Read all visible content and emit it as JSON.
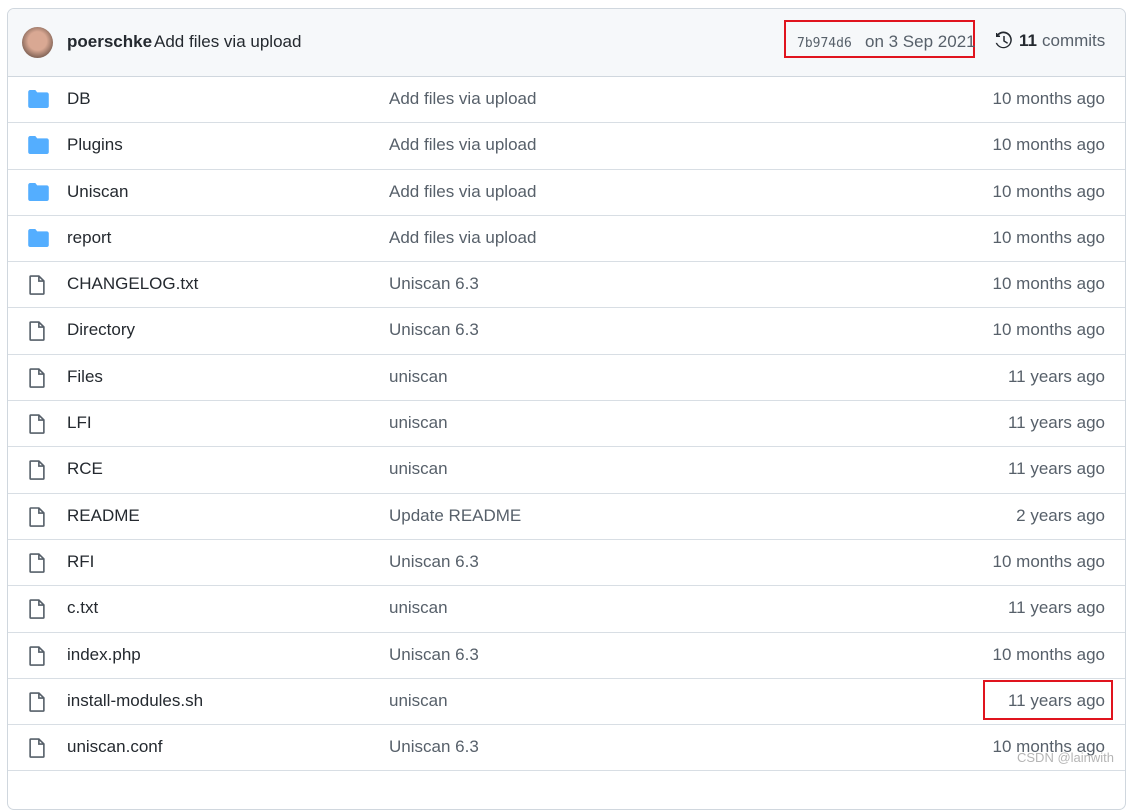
{
  "header": {
    "author": "poerschke",
    "message": "Add files via upload",
    "sha": "7b974d6",
    "date": "on 3 Sep 2021",
    "commit_count": "11",
    "commit_label": "commits"
  },
  "colors": {
    "folder": "#54aeff",
    "highlight": "#e0141e"
  },
  "files": [
    {
      "type": "folder",
      "name": "DB",
      "message": "Add files via upload",
      "age": "10 months ago"
    },
    {
      "type": "folder",
      "name": "Plugins",
      "message": "Add files via upload",
      "age": "10 months ago"
    },
    {
      "type": "folder",
      "name": "Uniscan",
      "message": "Add files via upload",
      "age": "10 months ago"
    },
    {
      "type": "folder",
      "name": "report",
      "message": "Add files via upload",
      "age": "10 months ago"
    },
    {
      "type": "file",
      "name": "CHANGELOG.txt",
      "message": "Uniscan 6.3",
      "age": "10 months ago"
    },
    {
      "type": "file",
      "name": "Directory",
      "message": "Uniscan 6.3",
      "age": "10 months ago"
    },
    {
      "type": "file",
      "name": "Files",
      "message": "uniscan",
      "age": "11 years ago"
    },
    {
      "type": "file",
      "name": "LFI",
      "message": "uniscan",
      "age": "11 years ago"
    },
    {
      "type": "file",
      "name": "RCE",
      "message": "uniscan",
      "age": "11 years ago"
    },
    {
      "type": "file",
      "name": "README",
      "message": "Update README",
      "age": "2 years ago"
    },
    {
      "type": "file",
      "name": "RFI",
      "message": "Uniscan 6.3",
      "age": "10 months ago"
    },
    {
      "type": "file",
      "name": "c.txt",
      "message": "uniscan",
      "age": "11 years ago"
    },
    {
      "type": "file",
      "name": "index.php",
      "message": "Uniscan 6.3",
      "age": "10 months ago"
    },
    {
      "type": "file",
      "name": "install-modules.sh",
      "message": "uniscan",
      "age": "11 years ago"
    },
    {
      "type": "file",
      "name": "uniscan.conf",
      "message": "Uniscan 6.3",
      "age": "10 months ago"
    }
  ],
  "watermark": "CSDN @lainwith"
}
